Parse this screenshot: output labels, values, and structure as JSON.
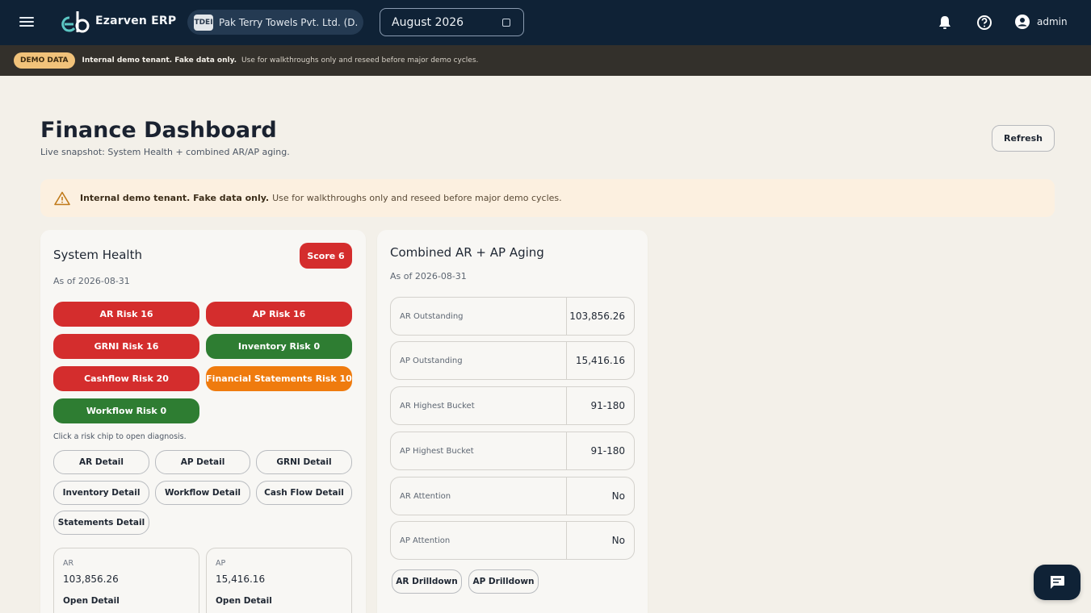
{
  "header": {
    "app_name": "Ezarven ERP",
    "tenant_badge": "TDEI",
    "tenant_name": "Pak Terry Towels Pvt. Ltd. (D...",
    "period": "August 2026",
    "user": "admin",
    "icons": [
      "menu-icon",
      "logo",
      "calendar-icon",
      "bell-icon",
      "help-icon",
      "account-icon"
    ]
  },
  "demo_strip": {
    "pill": "DEMO DATA",
    "bold": "Internal demo tenant. Fake data only.",
    "text": "Use for walkthroughs only and reseed before major demo cycles."
  },
  "page": {
    "title": "Finance Dashboard",
    "subtitle": "Live snapshot: System Health + combined AR/AP aging.",
    "refresh_label": "Refresh"
  },
  "alert": {
    "bold": "Internal demo tenant. Fake data only.",
    "text": "Use for walkthroughs only and reseed before major demo cycles."
  },
  "health": {
    "title": "System Health",
    "score": "Score 6",
    "as_of": "As of 2026-08-31",
    "chips": [
      {
        "label": "AR Risk 16",
        "status": "red"
      },
      {
        "label": "AP Risk 16",
        "status": "red"
      },
      {
        "label": "GRNI Risk 16",
        "status": "red"
      },
      {
        "label": "Inventory Risk 0",
        "status": "green"
      },
      {
        "label": "Cashflow Risk 20",
        "status": "red"
      },
      {
        "label": "Financial Statements Risk 10",
        "status": "orange"
      },
      {
        "label": "Workflow Risk 0",
        "status": "green"
      }
    ],
    "hint": "Click a risk chip to open diagnosis.",
    "details": [
      "AR Detail",
      "AP Detail",
      "GRNI Detail",
      "Inventory Detail",
      "Workflow Detail",
      "Cash Flow Detail",
      "Statements Detail"
    ],
    "mini": [
      {
        "label": "AR",
        "value": "103,856.26",
        "link": "Open Detail"
      },
      {
        "label": "AP",
        "value": "15,416.16",
        "link": "Open Detail"
      }
    ]
  },
  "aging": {
    "title": "Combined AR + AP Aging",
    "as_of": "As of 2026-08-31",
    "rows": [
      {
        "key": "AR Outstanding",
        "value": "103,856.26"
      },
      {
        "key": "AP Outstanding",
        "value": "15,416.16"
      },
      {
        "key": "AR Highest Bucket",
        "value": "91-180"
      },
      {
        "key": "AP Highest Bucket",
        "value": "91-180"
      },
      {
        "key": "AR Attention",
        "value": "No"
      },
      {
        "key": "AP Attention",
        "value": "No"
      }
    ],
    "drill": [
      "AR Drilldown",
      "AP Drilldown"
    ]
  },
  "colors": {
    "topbar": "#0f2236",
    "red": "#d42d2d",
    "green": "#2e7d32",
    "orange": "#ef7b0e",
    "demo_pill": "#f1c27a",
    "background": "#f3f0e9"
  }
}
